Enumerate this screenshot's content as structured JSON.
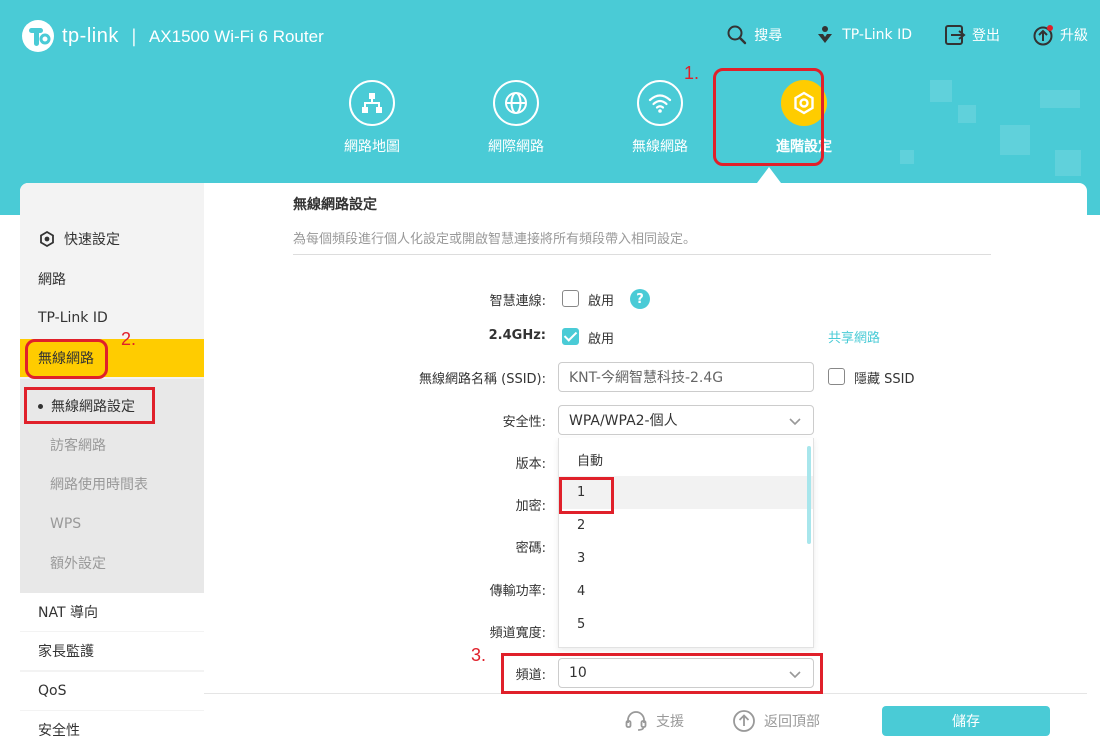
{
  "header": {
    "logo_text": "tp-link",
    "separator": "|",
    "model": "AX1500 Wi-Fi 6 Router",
    "top_links": [
      {
        "label": "搜尋",
        "icon": "search-icon"
      },
      {
        "label": "TP-Link ID",
        "icon": "tplink-id-icon"
      },
      {
        "label": "登出",
        "icon": "logout-icon"
      },
      {
        "label": "升級",
        "icon": "upgrade-icon"
      }
    ],
    "nav": [
      {
        "label": "網路地圖",
        "icon": "network-map-icon"
      },
      {
        "label": "網際網路",
        "icon": "globe-icon"
      },
      {
        "label": "無線網路",
        "icon": "wifi-icon"
      },
      {
        "label": "進階設定",
        "icon": "gear-icon",
        "active": true
      }
    ]
  },
  "annotations": {
    "step1": "1.",
    "step2": "2.",
    "step3": "3."
  },
  "sidebar": {
    "items": [
      {
        "label": "快速設定",
        "icon": "gear-icon"
      },
      {
        "label": "網路"
      },
      {
        "label": "TP-Link ID"
      },
      {
        "label": "無線網路",
        "active": true
      }
    ],
    "subitems": [
      {
        "label": "無線網路設定",
        "current": true
      },
      {
        "label": "訪客網路"
      },
      {
        "label": "網路使用時間表"
      },
      {
        "label": "WPS"
      },
      {
        "label": "額外設定"
      }
    ],
    "more_items": [
      {
        "label": "NAT 導向"
      },
      {
        "label": "家長監護"
      },
      {
        "label": "QoS"
      },
      {
        "label": "安全性"
      }
    ]
  },
  "section": {
    "title": "無線網路設定",
    "description": "為每個頻段進行個人化設定或開啟智慧連接將所有頻段帶入相同設定。"
  },
  "form": {
    "smart_connect": {
      "label": "智慧連線:",
      "checkbox_label": "啟用",
      "checked": false,
      "help": "?"
    },
    "band": {
      "label": "2.4GHz:",
      "checkbox_label": "啟用",
      "checked": true,
      "share_link": "共享網路"
    },
    "ssid": {
      "label": "無線網路名稱 (SSID):",
      "value": "KNT-今網智慧科技-2.4G",
      "hide_label": "隱藏 SSID"
    },
    "security": {
      "label": "安全性:",
      "value": "WPA/WPA2-個人"
    },
    "version": {
      "label": "版本:"
    },
    "encryption": {
      "label": "加密:"
    },
    "password": {
      "label": "密碼:"
    },
    "tx_power": {
      "label": "傳輸功率:"
    },
    "bandwidth": {
      "label": "頻道寬度:"
    },
    "channel": {
      "label": "頻道:",
      "value": "10"
    }
  },
  "dropdown": {
    "options": [
      "自動",
      "1",
      "2",
      "3",
      "4",
      "5"
    ],
    "hovered_index": 1
  },
  "footer": {
    "support": "支援",
    "back_to_top": "返回頂部",
    "save": "儲存"
  },
  "colors": {
    "header_bg": "#4acbd6",
    "accent": "#4acbd6",
    "active_yellow": "#ffcc00",
    "annotation_red": "#e0202a",
    "sidebar_bg": "#f3f3f3"
  }
}
